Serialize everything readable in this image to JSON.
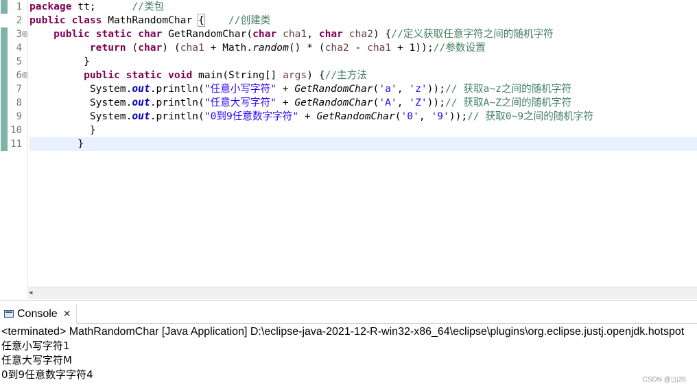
{
  "editor": {
    "line_numbers": [
      "1",
      "2",
      "3",
      "4",
      "5",
      "6",
      "7",
      "8",
      "9",
      "10",
      "11"
    ],
    "fold_markers": [
      "⊖",
      "⊖"
    ],
    "lines": [
      [
        {
          "t": "package",
          "c": "kw"
        },
        {
          "t": " tt;      "
        },
        {
          "t": "//类包",
          "c": "cm"
        }
      ],
      [
        {
          "t": "public",
          "c": "kw"
        },
        {
          "t": " "
        },
        {
          "t": "class",
          "c": "kw"
        },
        {
          "t": " MathRandomChar "
        },
        {
          "t": "{",
          "c": "brace-box"
        },
        {
          "t": "    "
        },
        {
          "t": "//创建类",
          "c": "cm"
        }
      ],
      [
        {
          "t": "    "
        },
        {
          "t": "public",
          "c": "kw"
        },
        {
          "t": " "
        },
        {
          "t": "static",
          "c": "kw"
        },
        {
          "t": " "
        },
        {
          "t": "char",
          "c": "kw"
        },
        {
          "t": " GetRandomChar("
        },
        {
          "t": "char",
          "c": "kw"
        },
        {
          "t": " "
        },
        {
          "t": "cha1",
          "c": "prm"
        },
        {
          "t": ", "
        },
        {
          "t": "char",
          "c": "kw"
        },
        {
          "t": " "
        },
        {
          "t": "cha2",
          "c": "prm"
        },
        {
          "t": ") {"
        },
        {
          "t": "//定义获取任意字符之间的随机字符",
          "c": "cm"
        }
      ],
      [
        {
          "t": "          "
        },
        {
          "t": "return",
          "c": "kw"
        },
        {
          "t": " ("
        },
        {
          "t": "char",
          "c": "kw"
        },
        {
          "t": ") ("
        },
        {
          "t": "cha1",
          "c": "prm"
        },
        {
          "t": " + Math."
        },
        {
          "t": "random",
          "c": "mth-i"
        },
        {
          "t": "() * ("
        },
        {
          "t": "cha2",
          "c": "prm"
        },
        {
          "t": " - "
        },
        {
          "t": "cha1",
          "c": "prm"
        },
        {
          "t": " + 1));"
        },
        {
          "t": "//参数设置",
          "c": "cm"
        }
      ],
      [
        {
          "t": "         }"
        }
      ],
      [
        {
          "t": "         "
        },
        {
          "t": "public",
          "c": "kw"
        },
        {
          "t": " "
        },
        {
          "t": "static",
          "c": "kw"
        },
        {
          "t": " "
        },
        {
          "t": "void",
          "c": "kw"
        },
        {
          "t": " main(String[] "
        },
        {
          "t": "args",
          "c": "prm"
        },
        {
          "t": ") {"
        },
        {
          "t": "//主方法",
          "c": "cm"
        }
      ],
      [
        {
          "t": "          System."
        },
        {
          "t": "out",
          "c": "fld"
        },
        {
          "t": ".println("
        },
        {
          "t": "\"任意小写字符\"",
          "c": "str"
        },
        {
          "t": " + "
        },
        {
          "t": "GetRandomChar",
          "c": "mth-i"
        },
        {
          "t": "("
        },
        {
          "t": "'a'",
          "c": "str"
        },
        {
          "t": ", "
        },
        {
          "t": "'z'",
          "c": "str"
        },
        {
          "t": "));"
        },
        {
          "t": "// 获取a~z之间的随机字符",
          "c": "cm"
        }
      ],
      [
        {
          "t": "          System."
        },
        {
          "t": "out",
          "c": "fld"
        },
        {
          "t": ".println("
        },
        {
          "t": "\"任意大写字符\"",
          "c": "str"
        },
        {
          "t": " + "
        },
        {
          "t": "GetRandomChar",
          "c": "mth-i"
        },
        {
          "t": "("
        },
        {
          "t": "'A'",
          "c": "str"
        },
        {
          "t": ", "
        },
        {
          "t": "'Z'",
          "c": "str"
        },
        {
          "t": "));"
        },
        {
          "t": "// 获取A~Z之间的随机字符",
          "c": "cm"
        }
      ],
      [
        {
          "t": "          System."
        },
        {
          "t": "out",
          "c": "fld"
        },
        {
          "t": ".println("
        },
        {
          "t": "\"0到9任意数字字符\"",
          "c": "str"
        },
        {
          "t": " + "
        },
        {
          "t": "GetRandomChar",
          "c": "mth-i"
        },
        {
          "t": "("
        },
        {
          "t": "'0'",
          "c": "str"
        },
        {
          "t": ", "
        },
        {
          "t": "'9'",
          "c": "str"
        },
        {
          "t": "));"
        },
        {
          "t": "// 获取0~9之间的随机字符",
          "c": "cm"
        }
      ],
      [
        {
          "t": "          }"
        }
      ],
      [
        {
          "t": "        }"
        }
      ]
    ],
    "current_line": 11
  },
  "console": {
    "tab_label": "Console",
    "close_glyph": "✕",
    "status": "<terminated> MathRandomChar [Java Application] D:\\eclipse-java-2021-12-R-win32-x86_64\\eclipse\\plugins\\org.eclipse.justj.openjdk.hotspot",
    "output": [
      "任意小写字符1",
      "任意大写字符M",
      "0到9任意数字字符4"
    ]
  },
  "watermark": "CSDN @▯▯26",
  "icons": {
    "console": "console-icon",
    "close": "close-icon",
    "fold": "fold-collapse-icon"
  }
}
